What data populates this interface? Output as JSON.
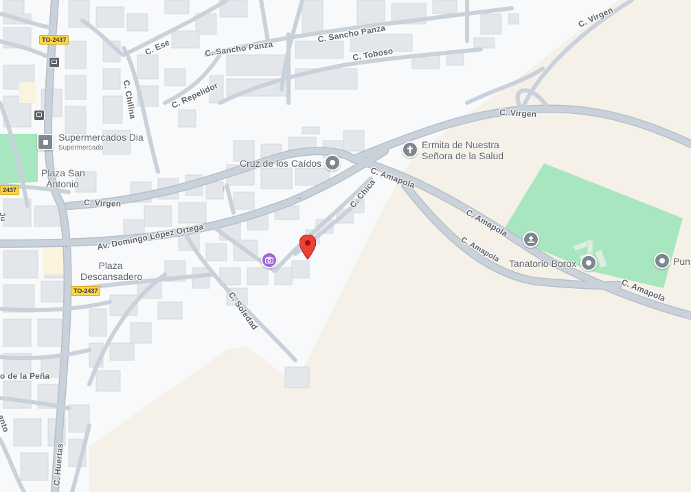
{
  "colors": {
    "background": "#f8f9fa",
    "sand": "#f5f0e8",
    "park": "#a8e6bf",
    "road": "#c7cfd8",
    "road_casing": "#b6bfc9",
    "building": "#e8eaed",
    "poi_gray": "#7d878f",
    "poi_purple": "#9e66d8",
    "marker_red": "#ea4335"
  },
  "streets": {
    "c_virgen_top": "C. Virgen",
    "c_sancho_panza_1": "C. Sancho Panza",
    "c_sancho_panza_2": "C. Sancho Panza",
    "c_toboso": "C. Toboso",
    "c_ese": "C. Ese",
    "c_repelidor": "C. Repelidor",
    "c_chilina": "C. Chilina",
    "c_virgen_right": "C. Virgen",
    "c_virgen_left": "C. Virgen",
    "av_domingo": "Av. Domingo López Ortega",
    "c_chica": "C. Chica",
    "c_amapola_1": "C. Amapola",
    "c_amapola_2": "C. Amapola",
    "c_amapola_3": "C. Amapola",
    "c_amapola_4": "C. Amapola",
    "c_soledad": "C. Soledad",
    "c_huertas": "C. Huertas",
    "de_la_pena": "o de la Peña",
    "anto": "anto"
  },
  "road_shields": {
    "to2437_top": "TO-2437",
    "to2437_left": "2437",
    "to2437_bottom": "TO-2437"
  },
  "places": {
    "supermercados_name": "Supermercados Dia",
    "supermercados_category": "Supermercado",
    "plaza_san_antonio_line1": "Plaza San",
    "plaza_san_antonio_line2": "Antonio",
    "plaza_descansadero_line1": "Plaza",
    "plaza_descansadero_line2": "Descansadero",
    "cruz_caidos": "Cruz de los Caídos",
    "ermita_line1": "Ermita de Nuestra",
    "ermita_line2": "Señora de la Salud",
    "tanatorio": "Tanatorio Borox",
    "pun": "Pun"
  },
  "icons": {
    "bus_stop": "bus-icon",
    "place_pin": "place-pin-icon",
    "church": "cross-icon",
    "camera": "camera-icon",
    "cemetery": "cemetery-icon",
    "marker": "map-marker-icon"
  }
}
